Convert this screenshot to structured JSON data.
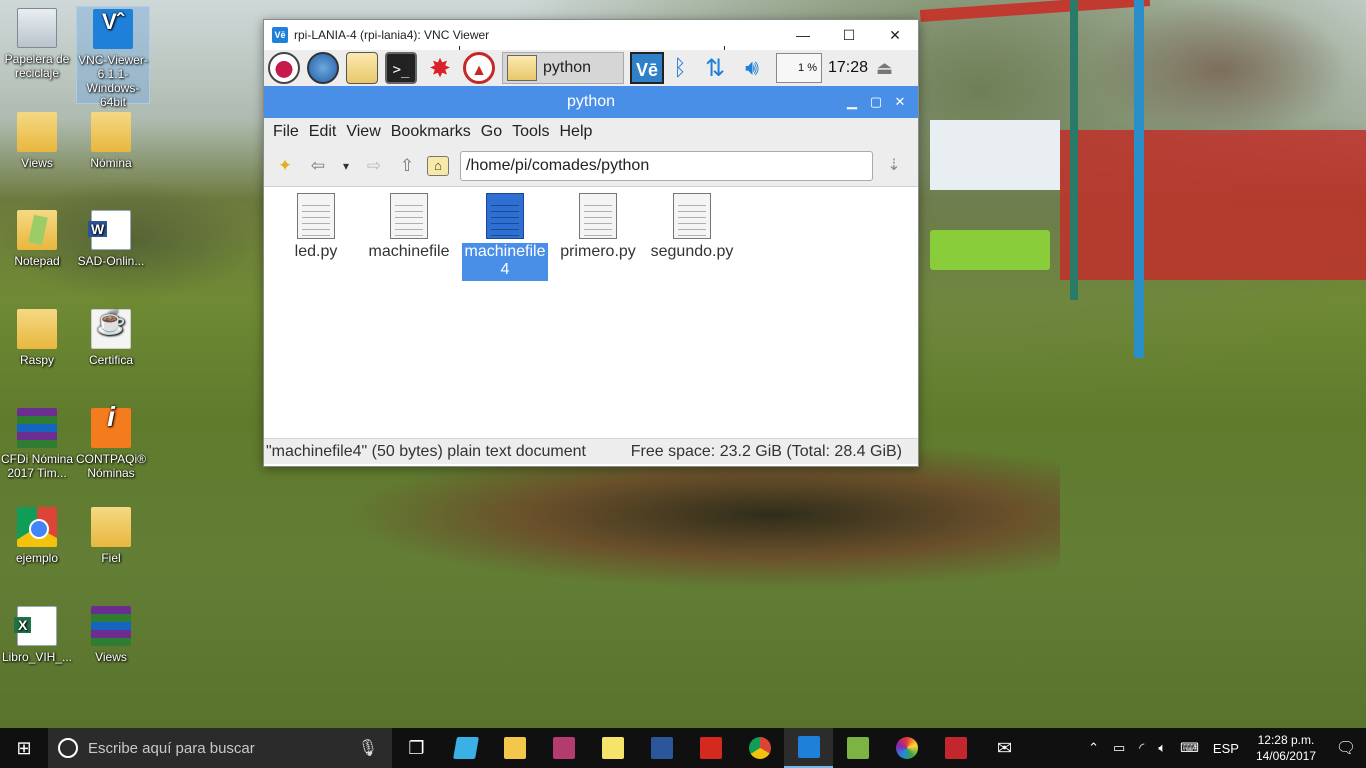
{
  "desktop": {
    "icons": [
      {
        "label": "Papelera de reciclaje",
        "icon": "recycle-bin-icon"
      },
      {
        "label": "VNC-Viewer-6.1.1-Windows-64bit",
        "icon": "vnc-viewer-icon"
      },
      {
        "label": "Views",
        "icon": "folder-icon"
      },
      {
        "label": "Nómina",
        "icon": "folder-icon"
      },
      {
        "label": "Notepad",
        "icon": "folder-icon"
      },
      {
        "label": "SAD-Onlin...",
        "icon": "word-document-icon"
      },
      {
        "label": "Raspy",
        "icon": "folder-icon"
      },
      {
        "label": "Certifica",
        "icon": "java-icon"
      },
      {
        "label": "CFDi Nómina 2017 Tim...",
        "icon": "winrar-icon"
      },
      {
        "label": "CONTPAQi® Nóminas",
        "icon": "contpaqi-icon"
      },
      {
        "label": "ejemplo",
        "icon": "chrome-icon"
      },
      {
        "label": "Fiel",
        "icon": "folder-icon"
      },
      {
        "label": "Libro_VIH_...",
        "icon": "excel-icon"
      },
      {
        "label": "Views",
        "icon": "winrar-icon"
      }
    ]
  },
  "vnc": {
    "title": "rpi-LANIA-4 (rpi-lania4): VNC Viewer",
    "logo": "Vē",
    "controls": {
      "minimize": "—",
      "maximize": "☐",
      "close": "✕"
    }
  },
  "pi_panel": {
    "task_label": "python",
    "vnc_label": "Vē",
    "cpu": "1 %",
    "clock": "17:28"
  },
  "file_manager": {
    "title": "python",
    "controls": {
      "minimize": "▁",
      "maximize": "▢",
      "close": "✕"
    },
    "menu": [
      "File",
      "Edit",
      "View",
      "Bookmarks",
      "Go",
      "Tools",
      "Help"
    ],
    "path": "/home/pi/comades/python",
    "files": [
      {
        "name": "led.py",
        "selected": false
      },
      {
        "name": "machinefile",
        "selected": false
      },
      {
        "name": "machinefile4",
        "selected": true
      },
      {
        "name": "primero.py",
        "selected": false
      },
      {
        "name": "segundo.py",
        "selected": false
      }
    ],
    "status_left": "\"machinefile4\" (50 bytes) plain text document",
    "status_right": "Free space: 23.2 GiB (Total: 28.4 GiB)"
  },
  "taskbar": {
    "search_placeholder": "Escribe aquí para buscar",
    "apps": [
      "task-view-icon",
      "shared-icon",
      "file-explorer-icon",
      "s-app-icon",
      "sticky-notes-icon",
      "word-icon",
      "acrobat-icon",
      "chrome-icon",
      "vnc-viewer-icon",
      "notepad-plus-icon",
      "photo-icon",
      "mendeley-icon",
      "mail-icon"
    ],
    "language": "ESP",
    "time": "12:28 p.m.",
    "date": "14/06/2017"
  }
}
